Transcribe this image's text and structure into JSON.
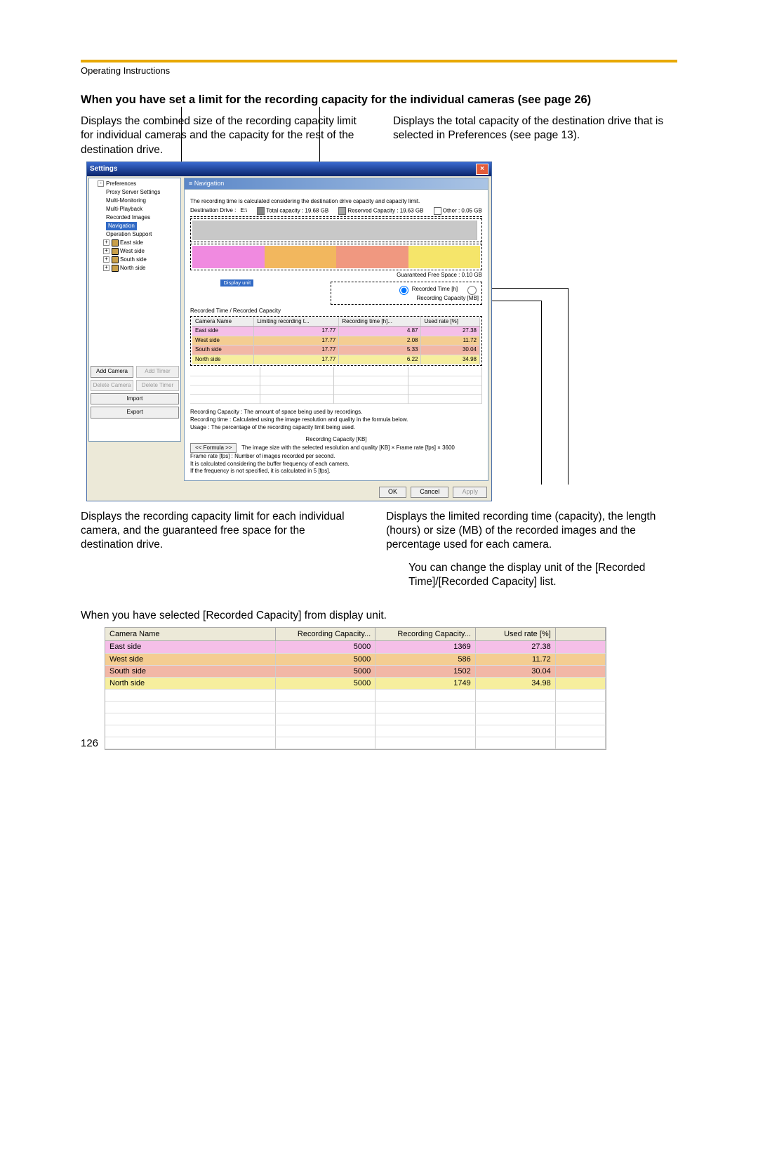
{
  "header": {
    "doc_label": "Operating Instructions"
  },
  "heading": "When you have set a limit for the recording capacity for the individual cameras (see page 26)",
  "callouts_top": {
    "left": "Displays the combined size of the recording capacity limit for individual cameras and the capacity for the rest of the destination drive.",
    "right": "Displays the total capacity of the destination drive that is selected in Preferences (see page 13)."
  },
  "settings_win": {
    "title": "Settings",
    "close_label": "×",
    "tree": {
      "root": "Preferences",
      "items": [
        "Proxy Server Settings",
        "Multi-Monitoring",
        "Multi-Playback",
        "Recorded Images",
        "Navigation",
        "Operation Support"
      ],
      "cameras": [
        "East side",
        "West side",
        "South side",
        "North side"
      ]
    },
    "nav_title": "Navigation",
    "desc_line": "The recording time is calculated considering the destination drive capacity and capacity limit.",
    "drive_info": {
      "dest_drive_label": "Destination Drive :",
      "dest_drive_value": "E:\\",
      "total_label": "Total capacity :",
      "total_value": "19.68 GB",
      "reserved_label": "Reserved Capacity :",
      "reserved_value": "19.63 GB",
      "other_label": "Other :",
      "other_value": "0.05 GB"
    },
    "guaranteed_label": "Guaranteed Free Space :",
    "guaranteed_value": "0.10 GB",
    "display_unit_title": "Display unit",
    "radio_time": "Recorded Time [h]",
    "radio_cap": "Recording Capacity [MB]",
    "table_title": "Recorded Time / Recorded Capacity",
    "table_headers": [
      "Camera Name",
      "Limiting recording t...",
      "Recording time [h]...",
      "Used rate [%]"
    ],
    "table_rows": [
      {
        "name": "East side",
        "limit": "17.77",
        "time": "4.87",
        "used": "27.38",
        "cls": "seg-pink"
      },
      {
        "name": "West side",
        "limit": "17.77",
        "time": "2.08",
        "used": "11.72",
        "cls": "seg-orange"
      },
      {
        "name": "South side",
        "limit": "17.77",
        "time": "5.33",
        "used": "30.04",
        "cls": "seg-salmon"
      },
      {
        "name": "North side",
        "limit": "17.77",
        "time": "6.22",
        "used": "34.98",
        "cls": "seg-yellow"
      }
    ],
    "help": {
      "l1": "Recording Capacity : The amount of space being used by recordings.",
      "l2": "Recording time : Calculated using the image resolution and quality in the formula below.",
      "l3": "Usage : The percentage of the recording capacity limit being used."
    },
    "formula": {
      "button": "<< Formula >>",
      "title": "Recording Capacity [KB]",
      "line": "The image size with the selected resolution and quality [KB] × Frame rate [fps] × 3600",
      "fr1": "Frame rate [fps] : Number of images recorded per second.",
      "fr2": "It is calculated considering the buffer frequency of each camera.",
      "fr3": "If the frequency is not specified, it is calculated in 5 [fps]."
    },
    "side_buttons": {
      "add_camera": "Add Camera",
      "add_timer": "Add Timer",
      "del_camera": "Delete Camera",
      "del_timer": "Delete Timer",
      "import": "Import",
      "export": "Export"
    },
    "footer": {
      "ok": "OK",
      "cancel": "Cancel",
      "apply": "Apply"
    }
  },
  "callouts_bot": {
    "left": "Displays the recording capacity limit for each individual camera, and the guaranteed free space for the destination drive.",
    "right1": "Displays the limited recording time (capacity), the length (hours) or size (MB) of the recorded images and the percentage used for each camera.",
    "right2": "You can change the display unit of the [Recorded Time]/[Recorded Capacity] list."
  },
  "mid_sentence": "When you have selected [Recorded Capacity] from display unit.",
  "table2": {
    "headers": [
      "Camera Name",
      "Recording Capacity...",
      "Recording Capacity...",
      "Used rate [%]"
    ],
    "rows": [
      {
        "name": "East side",
        "c1": "5000",
        "c2": "1369",
        "c3": "27.38",
        "cls": "row-pink"
      },
      {
        "name": "West side",
        "c1": "5000",
        "c2": "586",
        "c3": "11.72",
        "cls": "row-orange"
      },
      {
        "name": "South side",
        "c1": "5000",
        "c2": "1502",
        "c3": "30.04",
        "cls": "row-salmon"
      },
      {
        "name": "North side",
        "c1": "5000",
        "c2": "1749",
        "c3": "34.98",
        "cls": "row-yellow"
      }
    ]
  },
  "page_number": "126"
}
